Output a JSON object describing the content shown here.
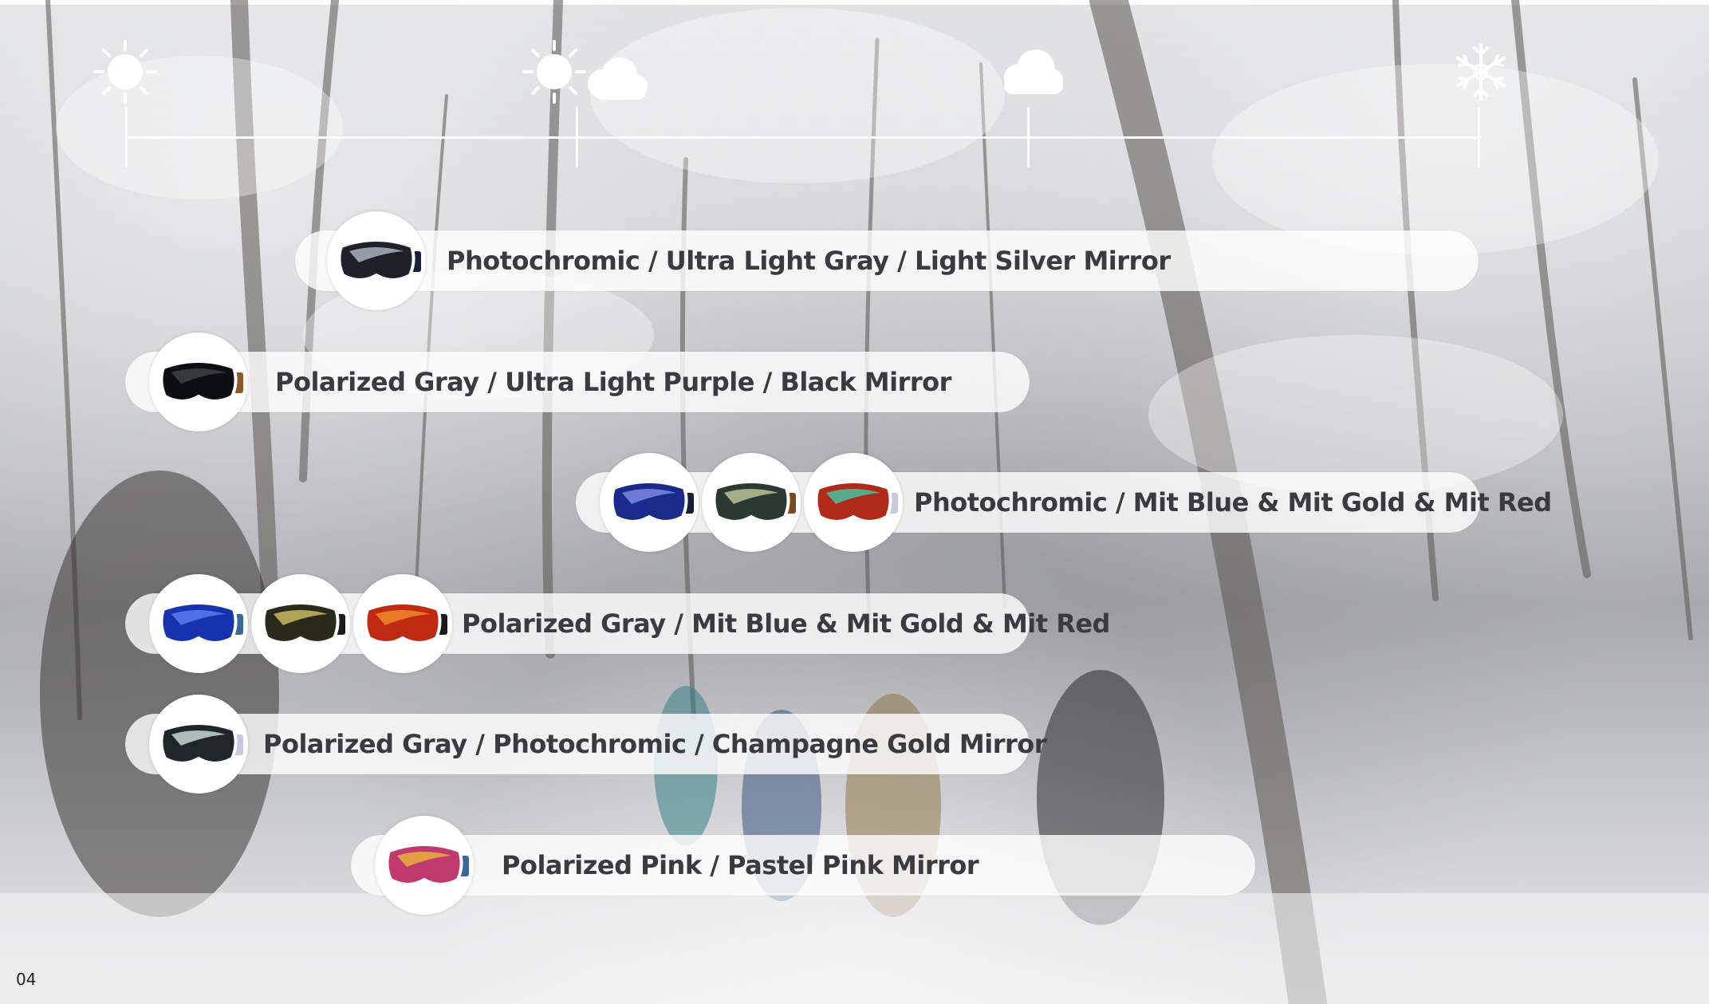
{
  "page_number": "04",
  "timeline": {
    "icons": [
      "sun-icon",
      "sun-cloud-icon",
      "cloud-icon",
      "snowflake-icon"
    ]
  },
  "options": [
    {
      "label": "Photochromic / Ultra Light Gray / Light Silver Mirror",
      "lenses": [
        {
          "icon": "goggle-gray-silver-icon",
          "tint": "#1e2228",
          "shine": "#a8b0bc",
          "strap": "#16203a"
        }
      ]
    },
    {
      "label": "Polarized Gray / Ultra Light Purple / Black Mirror",
      "lenses": [
        {
          "icon": "goggle-black-mirror-icon",
          "tint": "#0c0e12",
          "shine": "#3c4048",
          "strap": "#8a5a2a"
        }
      ]
    },
    {
      "label": "Photochromic / Mit Blue & Mit Gold & Mit Red",
      "lenses": [
        {
          "icon": "goggle-mit-blue-icon",
          "tint": "#1a2a8a",
          "shine": "#7c8ae0",
          "strap": "#141c3a"
        },
        {
          "icon": "goggle-mit-gold-icon",
          "tint": "#2a3a30",
          "shine": "#b8c29a",
          "strap": "#7a4a20"
        },
        {
          "icon": "goggle-mit-red-icon",
          "tint": "#b02a1a",
          "shine": "#4ac0a0",
          "strap": "#c8c8d8"
        }
      ]
    },
    {
      "label": "Polarized Gray / Mit Blue  & Mit Gold & Mit Red",
      "lenses": [
        {
          "icon": "goggle-mit-blue-icon",
          "tint": "#1632b0",
          "shine": "#5a7cf0",
          "strap": "#3a6a9a"
        },
        {
          "icon": "goggle-mit-gold-icon",
          "tint": "#2a2a1a",
          "shine": "#c8b860",
          "strap": "#1a1a1a"
        },
        {
          "icon": "goggle-mit-red-icon",
          "tint": "#c02a10",
          "shine": "#f08a2a",
          "strap": "#1a1a1a"
        }
      ]
    },
    {
      "label": "Polarized Gray / Photochromic / Champagne Gold Mirror",
      "lenses": [
        {
          "icon": "goggle-champagne-gold-icon",
          "tint": "#1e262c",
          "shine": "#c8d8d4",
          "strap": "#c8c8e0"
        }
      ]
    },
    {
      "label": "Polarized Pink / Pastel Pink Mirror",
      "lenses": [
        {
          "icon": "goggle-pastel-pink-icon",
          "tint": "#c03a70",
          "shine": "#e8b040",
          "strap": "#3a6a9a"
        }
      ]
    }
  ]
}
